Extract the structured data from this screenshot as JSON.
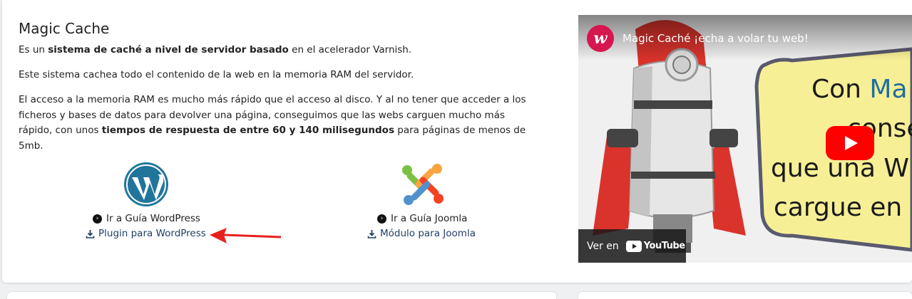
{
  "section": {
    "title": "Magic Cache",
    "p1": {
      "t1": "Es un ",
      "b1": "sistema de caché a nivel de servidor basado",
      "t2": " en el acelerador Varnish."
    },
    "p2": "Este sistema cachea todo el contenido de la web en la memoria RAM del servidor.",
    "p3": {
      "t1": "El acceso a la memoria RAM es mucho más rápido que el acceso al disco. Y al no tener que acceder a los ficheros y bases de datos para devolver una página, conseguimos que las webs carguen mucho más rápido, con unos ",
      "b1": "tiempos de respuesta de entre 60 y 140 milisegundos",
      "t2": " para páginas de menos de 5mb."
    }
  },
  "wordpress": {
    "guide_label": "Ir a Guía WordPress",
    "download_label": "Plugin para WordPress",
    "logo_icon": "wordpress-logo",
    "brand_color": "#21759b"
  },
  "joomla": {
    "guide_label": "Ir a Guía Joomla",
    "download_label": "Módulo para Joomla",
    "logo_icon": "joomla-logo"
  },
  "annotation": {
    "arrow_color": "#e8201c"
  },
  "video": {
    "channel_avatar": "w",
    "title": "Magic Caché ¡echa a volar tu web!",
    "promo_line1_prefix": "Con ",
    "promo_line1_highlight": "Ma",
    "promo_line2": "conse",
    "promo_line3": "que una W",
    "promo_line4": "cargue en",
    "watch_label": "Ver en",
    "youtube_label": "YouTube",
    "play_color": "#ff0000"
  }
}
